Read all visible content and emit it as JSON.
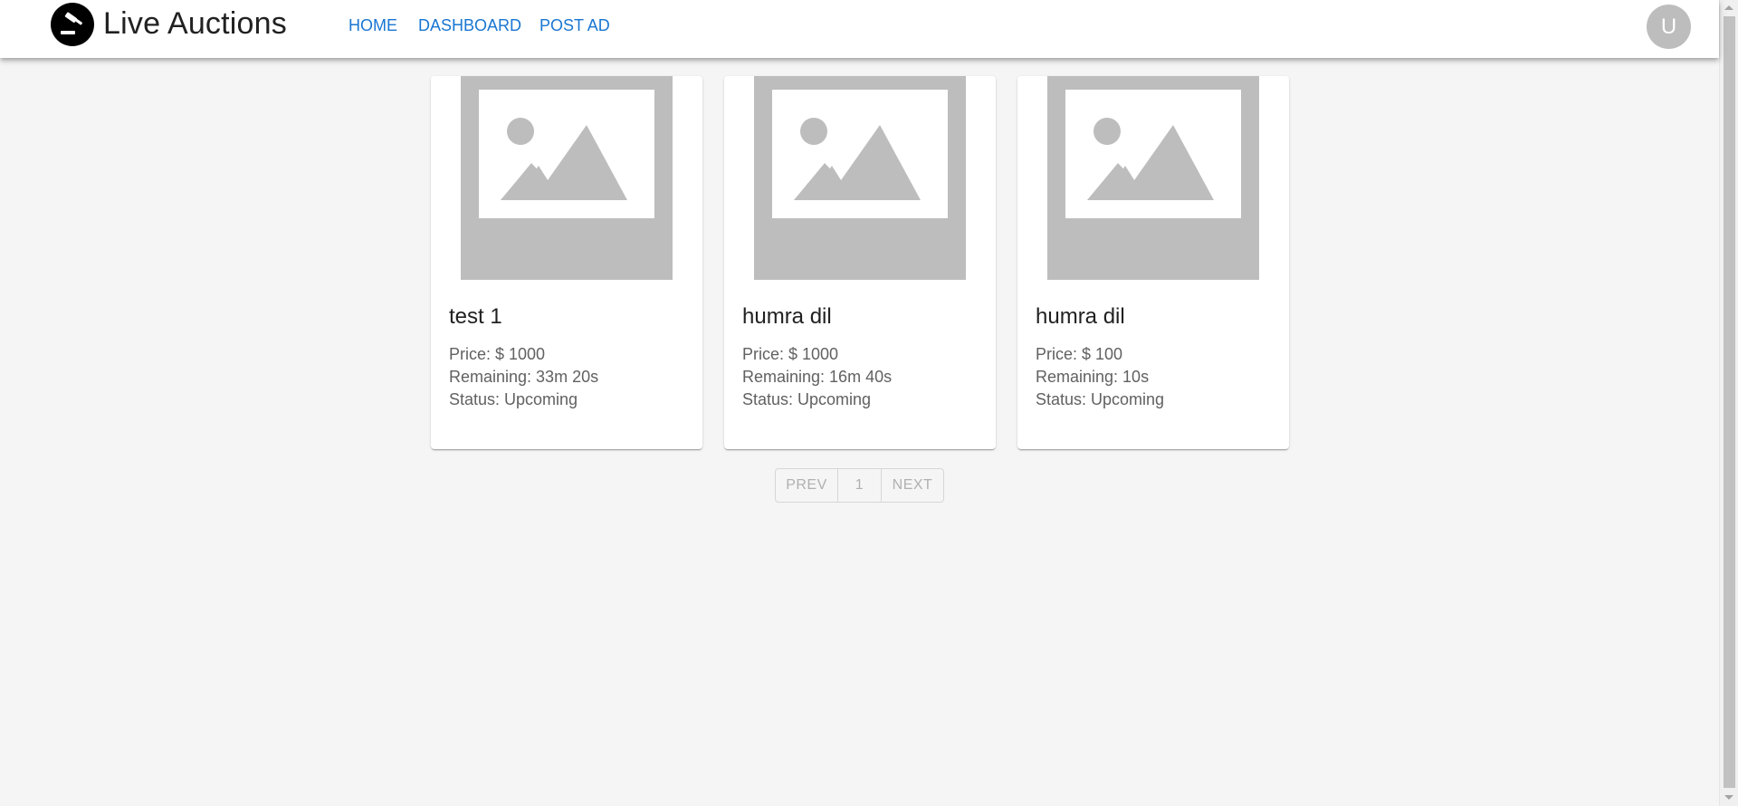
{
  "header": {
    "brand": "Live Auctions",
    "logo_icon": "gavel-icon",
    "nav": [
      {
        "label": "HOME"
      },
      {
        "label": "DASHBOARD"
      },
      {
        "label": "POST AD"
      }
    ],
    "avatar_letter": "U"
  },
  "auctions": [
    {
      "title": "test 1",
      "price": "Price: $ 1000",
      "remaining": "Remaining: 33m 20s",
      "status": "Status: Upcoming",
      "image_icon": "image-placeholder-icon"
    },
    {
      "title": "humra dil",
      "price": "Price: $ 1000",
      "remaining": "Remaining: 16m 40s",
      "status": "Status: Upcoming",
      "image_icon": "image-placeholder-icon"
    },
    {
      "title": "humra dil",
      "price": "Price: $ 100",
      "remaining": "Remaining: 10s",
      "status": "Status: Upcoming",
      "image_icon": "image-placeholder-icon"
    }
  ],
  "pagination": {
    "prev": "PREV",
    "page": "1",
    "next": "NEXT"
  },
  "colors": {
    "accent": "#1976d2",
    "background": "#f5f5f5",
    "placeholder": "#bdbdbd"
  }
}
